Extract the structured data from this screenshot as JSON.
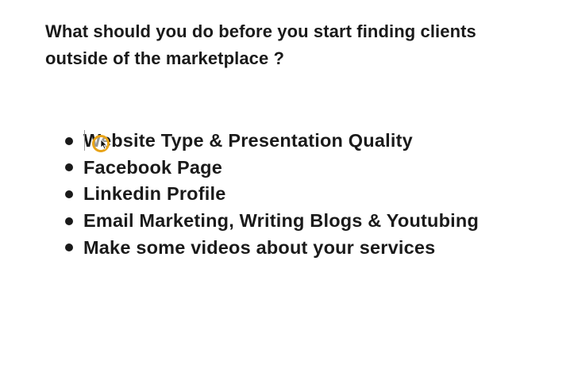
{
  "heading": "What should you do before you start finding clients outside of the marketplace ?",
  "bullets": [
    "Website Type & Presentation Quality",
    "Facebook Page",
    "Linkedin Profile",
    "Email Marketing, Writing Blogs & Youtubing",
    "Make some videos about your services"
  ],
  "colors": {
    "text": "#1a1a1a",
    "background": "#ffffff",
    "click_ring": "#e8a317"
  },
  "icons": {
    "bullet": "filled-circle",
    "pointer": "mouse-pointer-icon",
    "click_indicator": "click-ring-icon"
  }
}
